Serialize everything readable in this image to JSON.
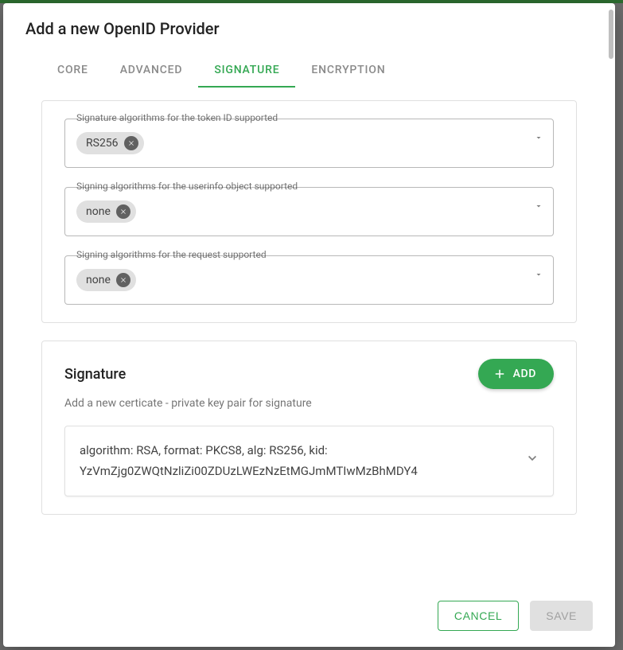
{
  "dialog": {
    "title": "Add a new OpenID Provider"
  },
  "tabs": {
    "items": [
      {
        "label": "CORE",
        "active": false
      },
      {
        "label": "ADVANCED",
        "active": false
      },
      {
        "label": "SIGNATURE",
        "active": true
      },
      {
        "label": "ENCRYPTION",
        "active": false
      }
    ]
  },
  "fields": {
    "token_id": {
      "label": "Signature algorithms for the token ID supported",
      "chips": [
        "RS256"
      ]
    },
    "userinfo": {
      "label": "Signing algorithms for the userinfo object supported",
      "chips": [
        "none"
      ]
    },
    "request": {
      "label": "Signing algorithms for the request supported",
      "chips": [
        "none"
      ]
    }
  },
  "signature_panel": {
    "heading": "Signature",
    "subtext": "Add a new certicate - private key pair for signature",
    "add_button": "ADD",
    "certificates": [
      "algorithm: RSA, format: PKCS8, alg: RS256, kid: YzVmZjg0ZWQtNzliZi00ZDUzLWEzNzEtMGJmMTIwMzBhMDY4"
    ]
  },
  "actions": {
    "cancel": "CANCEL",
    "save": "SAVE"
  }
}
